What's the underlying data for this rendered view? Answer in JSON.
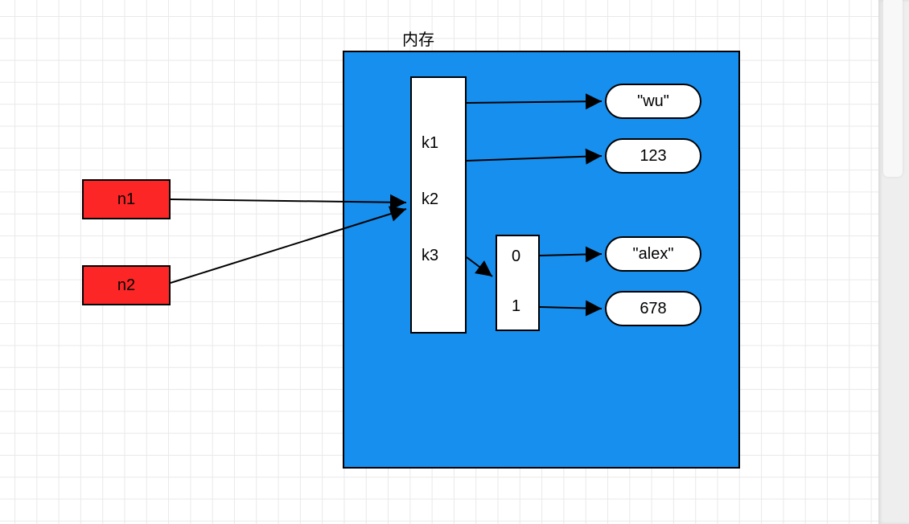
{
  "title": "内存",
  "vars": {
    "n1": "n1",
    "n2": "n2"
  },
  "keys": {
    "k1": "k1",
    "k2": "k2",
    "k3": "k3"
  },
  "indices": {
    "i0": "0",
    "i1": "1"
  },
  "values": {
    "v_wu": "\"wu\"",
    "v_123": "123",
    "v_alex": "\"alex\"",
    "v_678": "678"
  }
}
